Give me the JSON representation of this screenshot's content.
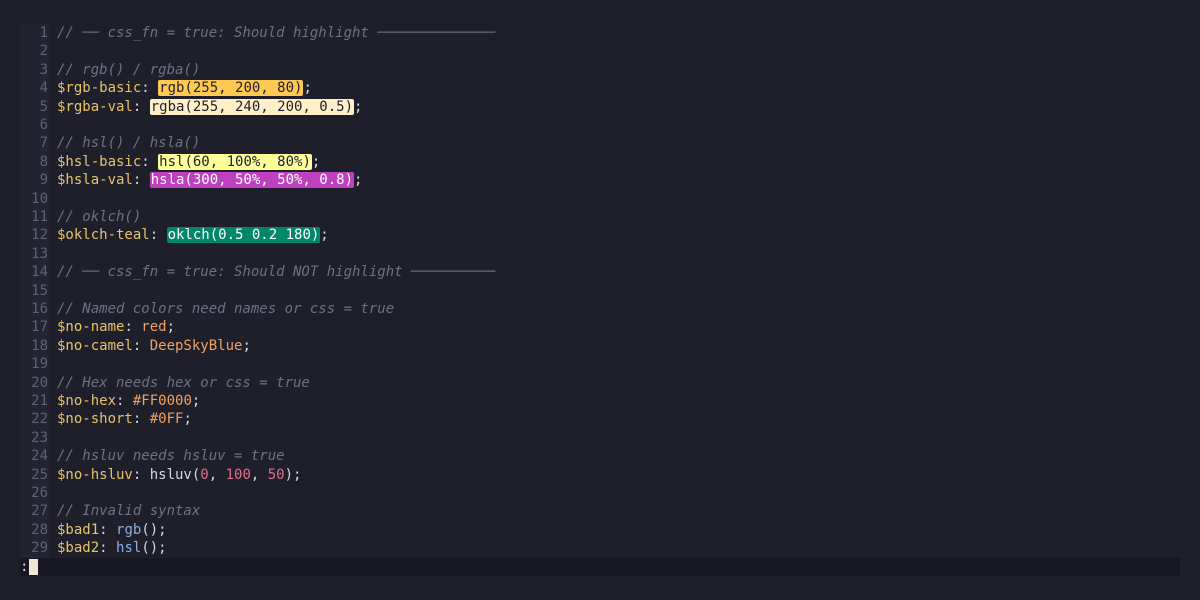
{
  "editor": {
    "lines": [
      {
        "n": "1",
        "segments": [
          {
            "t": "// ── css_fn = true: Should highlight ──────────────",
            "c": "comment"
          }
        ]
      },
      {
        "n": "2",
        "segments": []
      },
      {
        "n": "3",
        "segments": [
          {
            "t": "// rgb() / rgba()",
            "c": "comment"
          }
        ]
      },
      {
        "n": "4",
        "segments": [
          {
            "t": "$rgb-basic",
            "c": "var"
          },
          {
            "t": ": ",
            "c": "punct"
          },
          {
            "t": "rgb(255, 200, 80)",
            "c": "swatch",
            "bg": "#ffc850",
            "fg": "#1f1f2b"
          },
          {
            "t": ";",
            "c": "punct"
          }
        ]
      },
      {
        "n": "5",
        "segments": [
          {
            "t": "$rgba-val",
            "c": "var"
          },
          {
            "t": ": ",
            "c": "punct"
          },
          {
            "t": "rgba(255, 240, 200, 0.5)",
            "c": "swatch",
            "bg": "#fff0c8",
            "fg": "#1f1f2b"
          },
          {
            "t": ";",
            "c": "punct"
          }
        ]
      },
      {
        "n": "6",
        "segments": []
      },
      {
        "n": "7",
        "segments": [
          {
            "t": "// hsl() / hsla()",
            "c": "comment"
          }
        ]
      },
      {
        "n": "8",
        "segments": [
          {
            "t": "$hsl-basic",
            "c": "var"
          },
          {
            "t": ": ",
            "c": "punct"
          },
          {
            "t": "hsl(60, 100%, 80%)",
            "c": "swatch",
            "bg": "#ffff99",
            "fg": "#1f1f2b"
          },
          {
            "t": ";",
            "c": "punct"
          }
        ]
      },
      {
        "n": "9",
        "segments": [
          {
            "t": "$hsla-val",
            "c": "var"
          },
          {
            "t": ": ",
            "c": "punct"
          },
          {
            "t": "hsla(300, 50%, 50%, 0.8)",
            "c": "swatch",
            "bg": "#bf40bf",
            "fg": "#ffffff"
          },
          {
            "t": ";",
            "c": "punct"
          }
        ]
      },
      {
        "n": "10",
        "segments": []
      },
      {
        "n": "11",
        "segments": [
          {
            "t": "// oklch()",
            "c": "comment"
          }
        ]
      },
      {
        "n": "12",
        "segments": [
          {
            "t": "$oklch-teal",
            "c": "var"
          },
          {
            "t": ": ",
            "c": "punct"
          },
          {
            "t": "oklch(0.5 0.2 180)",
            "c": "swatch",
            "bg": "#00876a",
            "fg": "#ffffff"
          },
          {
            "t": ";",
            "c": "punct"
          }
        ]
      },
      {
        "n": "13",
        "segments": []
      },
      {
        "n": "14",
        "segments": [
          {
            "t": "// ── css_fn = true: Should NOT highlight ──────────",
            "c": "comment"
          }
        ]
      },
      {
        "n": "15",
        "segments": []
      },
      {
        "n": "16",
        "segments": [
          {
            "t": "// Named colors need names or css = true",
            "c": "comment"
          }
        ]
      },
      {
        "n": "17",
        "segments": [
          {
            "t": "$no-name",
            "c": "var"
          },
          {
            "t": ": ",
            "c": "punct"
          },
          {
            "t": "red",
            "c": "str"
          },
          {
            "t": ";",
            "c": "punct"
          }
        ]
      },
      {
        "n": "18",
        "segments": [
          {
            "t": "$no-camel",
            "c": "var"
          },
          {
            "t": ": ",
            "c": "punct"
          },
          {
            "t": "DeepSkyBlue",
            "c": "str"
          },
          {
            "t": ";",
            "c": "punct"
          }
        ]
      },
      {
        "n": "19",
        "segments": []
      },
      {
        "n": "20",
        "segments": [
          {
            "t": "// Hex needs hex or css = true",
            "c": "comment"
          }
        ]
      },
      {
        "n": "21",
        "segments": [
          {
            "t": "$no-hex",
            "c": "var"
          },
          {
            "t": ": ",
            "c": "punct"
          },
          {
            "t": "#FF0000",
            "c": "str"
          },
          {
            "t": ";",
            "c": "punct"
          }
        ]
      },
      {
        "n": "22",
        "segments": [
          {
            "t": "$no-short",
            "c": "var"
          },
          {
            "t": ": ",
            "c": "punct"
          },
          {
            "t": "#0FF",
            "c": "str"
          },
          {
            "t": ";",
            "c": "punct"
          }
        ]
      },
      {
        "n": "23",
        "segments": []
      },
      {
        "n": "24",
        "segments": [
          {
            "t": "// hsluv needs hsluv = true",
            "c": "comment"
          }
        ]
      },
      {
        "n": "25",
        "segments": [
          {
            "t": "$no-hsluv",
            "c": "var"
          },
          {
            "t": ": ",
            "c": "punct"
          },
          {
            "t": "hsluv(",
            "c": "plain"
          },
          {
            "t": "0",
            "c": "num"
          },
          {
            "t": ", ",
            "c": "plain"
          },
          {
            "t": "100",
            "c": "num"
          },
          {
            "t": ", ",
            "c": "plain"
          },
          {
            "t": "50",
            "c": "num"
          },
          {
            "t": ");",
            "c": "punct"
          }
        ]
      },
      {
        "n": "26",
        "segments": []
      },
      {
        "n": "27",
        "segments": [
          {
            "t": "// Invalid syntax",
            "c": "comment"
          }
        ]
      },
      {
        "n": "28",
        "segments": [
          {
            "t": "$bad1",
            "c": "var"
          },
          {
            "t": ": ",
            "c": "punct"
          },
          {
            "t": "rgb",
            "c": "fn"
          },
          {
            "t": "();",
            "c": "punct"
          }
        ]
      },
      {
        "n": "29",
        "segments": [
          {
            "t": "$bad2",
            "c": "var"
          },
          {
            "t": ": ",
            "c": "punct"
          },
          {
            "t": "hsl",
            "c": "fn"
          },
          {
            "t": "();",
            "c": "punct"
          }
        ]
      }
    ]
  },
  "cmdline": {
    "prompt": ":"
  },
  "colors": {
    "background": "#1f1f2b",
    "gutter": "#232331",
    "line_number": "#5f6377",
    "comment": "#6e7086",
    "variable": "#e6c36a",
    "function": "#8ab0e6",
    "number": "#e0708a",
    "string": "#f0a060",
    "cursor": "#f0e6d8"
  }
}
